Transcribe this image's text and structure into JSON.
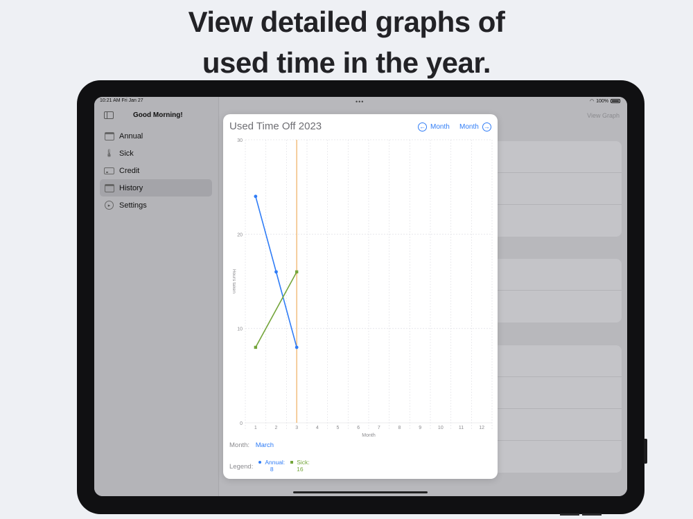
{
  "headline": {
    "line1": "View detailed graphs of",
    "line2": "used time in the year."
  },
  "status_bar": {
    "time": "10:21 AM  Fri Jan 27",
    "battery": "100%"
  },
  "sidebar": {
    "greeting": "Good Morning!",
    "items": [
      {
        "label": "Annual",
        "icon": "calendar-icon"
      },
      {
        "label": "Sick",
        "icon": "thermometer-icon"
      },
      {
        "label": "Credit",
        "icon": "credit-card-icon"
      },
      {
        "label": "History",
        "icon": "history-calendar-icon",
        "selected": true
      },
      {
        "label": "Settings",
        "icon": "gear-icon"
      }
    ]
  },
  "content": {
    "view_graph": "View Graph"
  },
  "modal": {
    "title": "Used Time Off 2023",
    "prev_label": "Month",
    "next_label": "Month",
    "month_label": "Month:",
    "month_value": "March",
    "legend_label": "Legend:",
    "legend": [
      {
        "name": "Annual:",
        "value": "8",
        "color": "#2f7cf6"
      },
      {
        "name": "Sick:",
        "value": "16",
        "color": "#74a53b"
      }
    ]
  },
  "chart_data": {
    "type": "line",
    "xlabel": "Month",
    "ylabel": "Hours taken",
    "x": [
      1,
      2,
      3,
      4,
      5,
      6,
      7,
      8,
      9,
      10,
      11,
      12
    ],
    "ylim": [
      0,
      30
    ],
    "yticks": [
      0,
      10,
      20,
      30
    ],
    "highlight_x": 3,
    "grid": true,
    "series": [
      {
        "name": "Annual",
        "color": "#2f7cf6",
        "points": [
          [
            1,
            24
          ],
          [
            2,
            16
          ],
          [
            3,
            8
          ]
        ]
      },
      {
        "name": "Sick",
        "color": "#74a53b",
        "points": [
          [
            1,
            8
          ],
          [
            3,
            16
          ]
        ]
      }
    ]
  }
}
